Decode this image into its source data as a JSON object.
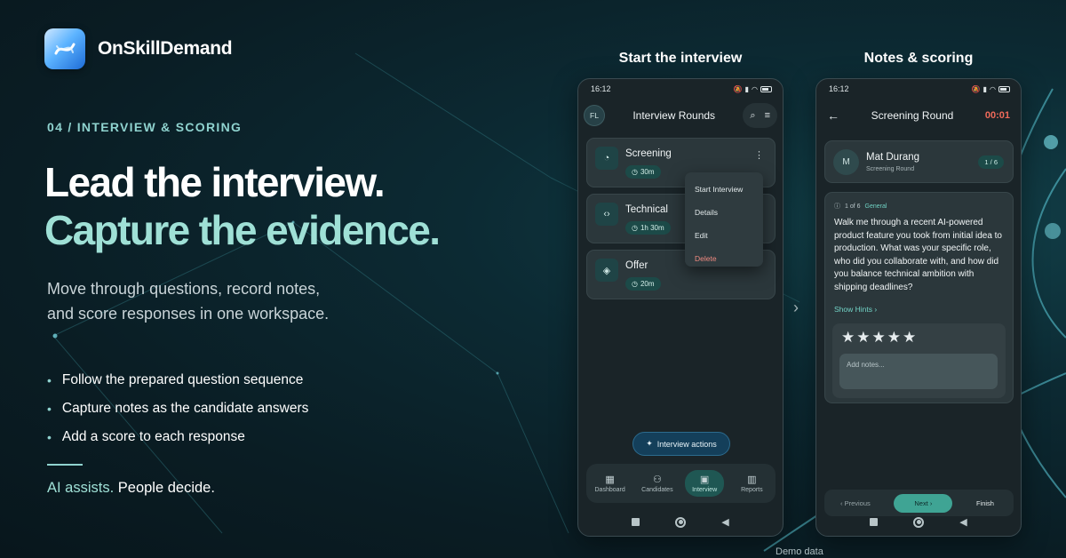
{
  "brand": {
    "name": "OnSkillDemand"
  },
  "hero": {
    "eyebrow": "04 / INTERVIEW & SCORING",
    "headline_1": "Lead the interview.",
    "headline_2": "Capture the evidence.",
    "lead_line_1": "Move through questions, record notes,",
    "lead_line_2": "and score responses in one workspace.",
    "bullets": [
      "Follow the prepared question sequence",
      "Capture notes as the candidate answers",
      "Add a score to each response"
    ],
    "tagline_ai": "AI assists.",
    "tagline_rest": " People decide."
  },
  "labels": {
    "phone1_title": "Start the interview",
    "phone2_title": "Notes & scoring",
    "demo": "Demo data"
  },
  "colors": {
    "accent": "#9fe0d6",
    "timer": "#ef6a5a",
    "danger": "#ef8a80",
    "next": "#3fa494"
  },
  "phone1": {
    "time": "16:12",
    "avatar": "FL",
    "title": "Interview Rounds",
    "rounds": [
      {
        "name": "Screening",
        "duration": "30m",
        "icon": "gauge-icon"
      },
      {
        "name": "Technical",
        "duration": "1h 30m",
        "icon": "code-icon"
      },
      {
        "name": "Offer",
        "duration": "20m",
        "icon": "handshake-icon"
      }
    ],
    "menu": [
      "Start Interview",
      "Details",
      "Edit",
      "Delete"
    ],
    "fab": "Interview actions",
    "nav": [
      {
        "label": "Dashboard",
        "icon": "grid-icon"
      },
      {
        "label": "Candidates",
        "icon": "people-icon"
      },
      {
        "label": "Interview",
        "icon": "calendar-icon",
        "active": true
      },
      {
        "label": "Reports",
        "icon": "chart-icon"
      }
    ]
  },
  "phone2": {
    "time": "16:12",
    "title": "Screening Round",
    "timer": "00:01",
    "candidate": {
      "initial": "M",
      "name": "Mat Durang",
      "round": "Screening Round",
      "progress": "1 / 6"
    },
    "question": {
      "counter": "1 of 6",
      "category": "General",
      "text": "Walk me through a recent AI-powered product feature you took from initial idea to production. What was your specific role, who did you collaborate with, and how did you balance technical ambition with shipping deadlines?",
      "hints": "Show Hints"
    },
    "rating": {
      "stars": "★★★★★"
    },
    "notes_placeholder": "Add notes...",
    "footer": {
      "previous": "Previous",
      "next": "Next",
      "finish": "Finish"
    }
  }
}
